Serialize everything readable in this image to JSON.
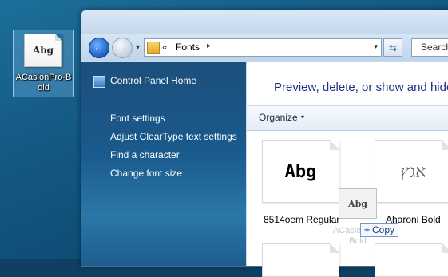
{
  "desktop": {
    "icon": {
      "sample": "Abg",
      "label": "ACaslonPro-Bold"
    }
  },
  "window": {
    "address": {
      "chevrons": "«",
      "path": "Fonts",
      "separator": "▸",
      "dropdown": "▾"
    },
    "search_placeholder": "Search",
    "left_pane": {
      "home_link": "Control Panel Home",
      "tasks": [
        "Font settings",
        "Adjust ClearType text settings",
        "Find a character",
        "Change font size"
      ]
    },
    "content": {
      "title": "Preview, delete, or show and hide",
      "toolbar": {
        "organize": "Organize",
        "organize_arrow": "▾"
      },
      "fonts": [
        {
          "sample": "Abg",
          "name": "8514oem Regular"
        },
        {
          "sample": "אגץ",
          "name": "Aharoni Bold"
        }
      ]
    }
  },
  "drag": {
    "ghost_sample": "Abg",
    "ghost_label": "ACaslonPro-Bold",
    "tooltip": {
      "plus": "+",
      "text": "Copy"
    }
  }
}
